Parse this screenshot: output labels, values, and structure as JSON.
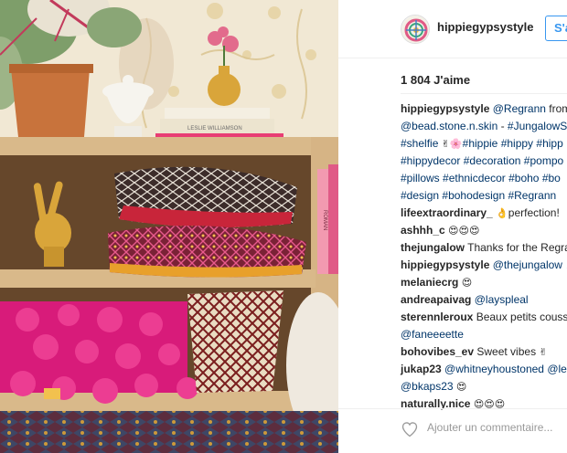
{
  "post": {
    "username": "hippiegypsystyle",
    "follow_label": "S'a",
    "likes": "1 804 J'aime",
    "add_comment_placeholder": "Ajouter un commentaire...",
    "photo_book_labels": [
      "LESLIE WILLIAMSON",
      "ROMAN"
    ]
  },
  "caption": {
    "lines": [
      [
        {
          "k": "u",
          "v": "hippiegypsystyle"
        },
        {
          "k": "t",
          "v": " "
        },
        {
          "k": "tag",
          "v": "@Regrann"
        },
        {
          "k": "t",
          "v": " from"
        }
      ],
      [
        {
          "k": "tag",
          "v": "@bead.stone.n.skin"
        },
        {
          "k": "t",
          "v": " - "
        },
        {
          "k": "tag",
          "v": "#JungalowS"
        }
      ],
      [
        {
          "k": "tag",
          "v": "#shelfie"
        },
        {
          "k": "t",
          "v": " "
        },
        {
          "k": "e",
          "v": "✌🌸"
        },
        {
          "k": "tag",
          "v": "#hippie"
        },
        {
          "k": "t",
          "v": " "
        },
        {
          "k": "tag",
          "v": "#hippy"
        },
        {
          "k": "t",
          "v": " "
        },
        {
          "k": "tag",
          "v": "#hipp"
        }
      ],
      [
        {
          "k": "tag",
          "v": "#hippydecor"
        },
        {
          "k": "t",
          "v": " "
        },
        {
          "k": "tag",
          "v": "#decoration"
        },
        {
          "k": "t",
          "v": " "
        },
        {
          "k": "tag",
          "v": "#pompo"
        }
      ],
      [
        {
          "k": "tag",
          "v": "#pillows"
        },
        {
          "k": "t",
          "v": " "
        },
        {
          "k": "tag",
          "v": "#ethnicdecor"
        },
        {
          "k": "t",
          "v": " "
        },
        {
          "k": "tag",
          "v": "#boho"
        },
        {
          "k": "t",
          "v": " "
        },
        {
          "k": "tag",
          "v": "#bo"
        }
      ],
      [
        {
          "k": "tag",
          "v": "#design"
        },
        {
          "k": "t",
          "v": " "
        },
        {
          "k": "tag",
          "v": "#bohodesign"
        },
        {
          "k": "t",
          "v": " "
        },
        {
          "k": "tag",
          "v": "#Regrann"
        }
      ]
    ]
  },
  "comments": [
    [
      {
        "k": "u",
        "v": "lifeextraordinary_"
      },
      {
        "k": "t",
        "v": " "
      },
      {
        "k": "e",
        "v": "👌"
      },
      {
        "k": "t",
        "v": "perfection!"
      }
    ],
    [
      {
        "k": "u",
        "v": "ashhh_c"
      },
      {
        "k": "t",
        "v": " "
      },
      {
        "k": "e",
        "v": "😍😍😍"
      }
    ],
    [
      {
        "k": "u",
        "v": "thejungalow"
      },
      {
        "k": "t",
        "v": " Thanks for the Regra"
      }
    ],
    [
      {
        "k": "u",
        "v": "hippiegypsystyle"
      },
      {
        "k": "t",
        "v": " "
      },
      {
        "k": "tag",
        "v": "@thejungalow"
      },
      {
        "k": "t",
        "v": " "
      },
      {
        "k": "e",
        "v": "🙏"
      }
    ],
    [
      {
        "k": "u",
        "v": "melaniecrg"
      },
      {
        "k": "t",
        "v": " "
      },
      {
        "k": "e",
        "v": "😍"
      }
    ],
    [
      {
        "k": "u",
        "v": "andreapaivag"
      },
      {
        "k": "t",
        "v": " "
      },
      {
        "k": "tag",
        "v": "@layspleal"
      }
    ],
    [
      {
        "k": "u",
        "v": "sterennleroux"
      },
      {
        "k": "t",
        "v": " Beaux petits couss"
      }
    ],
    [
      {
        "k": "tag",
        "v": "@faneeeette"
      }
    ],
    [
      {
        "k": "u",
        "v": "bohovibes_ev"
      },
      {
        "k": "t",
        "v": " Sweet vibes "
      },
      {
        "k": "e",
        "v": "✌"
      }
    ],
    [
      {
        "k": "u",
        "v": "jukap23"
      },
      {
        "k": "t",
        "v": " "
      },
      {
        "k": "tag",
        "v": "@whitneyhoustoned"
      },
      {
        "k": "t",
        "v": " "
      },
      {
        "k": "tag",
        "v": "@le"
      }
    ],
    [
      {
        "k": "tag",
        "v": "@bkaps23"
      },
      {
        "k": "t",
        "v": " "
      },
      {
        "k": "e",
        "v": "😍"
      }
    ],
    [
      {
        "k": "u",
        "v": "naturally.nice"
      },
      {
        "k": "t",
        "v": " "
      },
      {
        "k": "e",
        "v": "😍😍😍"
      }
    ]
  ],
  "colors": {
    "link": "#003569",
    "follow_blue": "#3897f0",
    "pink": "#e91e8c",
    "wood": "#d9b98a"
  },
  "icons": {
    "avatar": "avatar-logo",
    "heart": "heart-outline-icon"
  }
}
